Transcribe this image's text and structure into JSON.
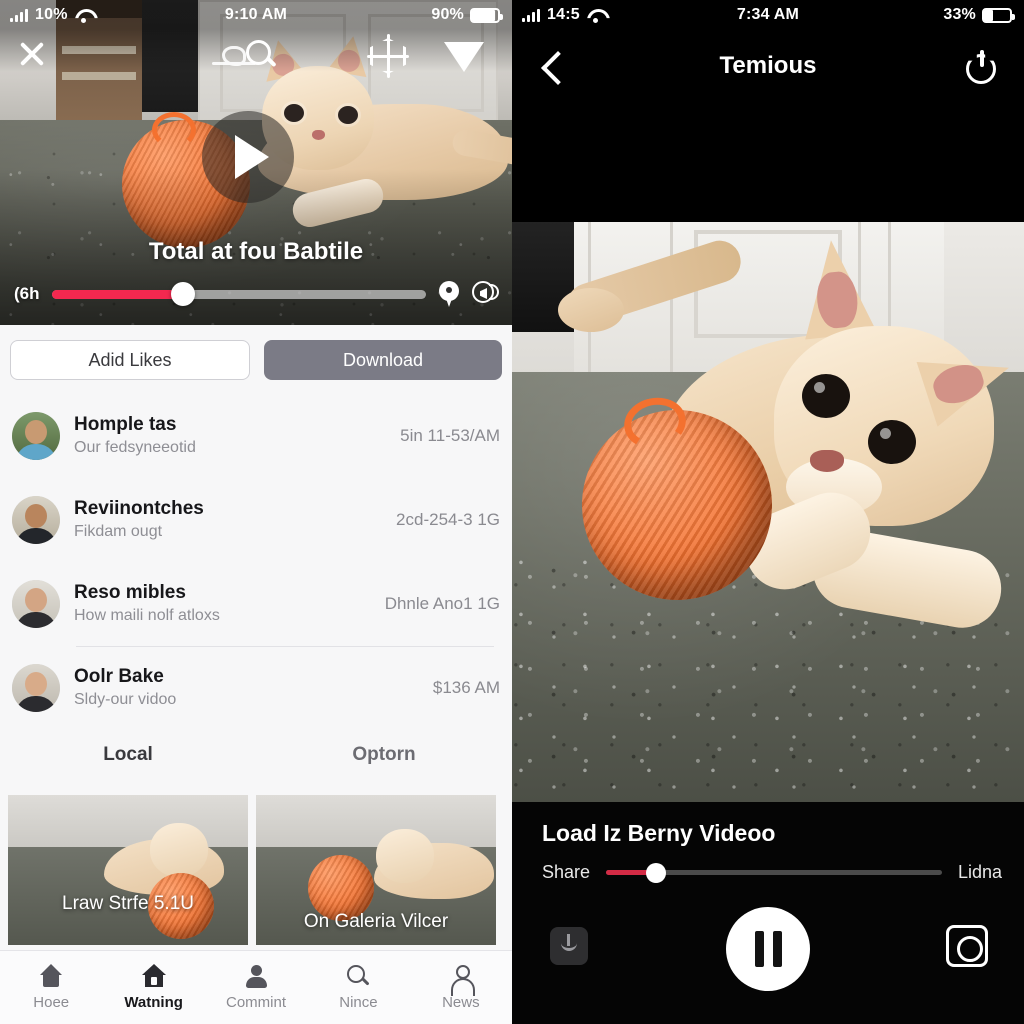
{
  "left": {
    "status": {
      "signal_label": "10%",
      "time": "9:10 AM",
      "battery": "90%",
      "battery_pct": 90
    },
    "overlay_icons": {
      "close": "close-icon",
      "search": "search-icon",
      "target": "target-icon",
      "triangle": "triangle-icon"
    },
    "video": {
      "title": "Total at fou Babtile",
      "elapsed": "(6h",
      "progress_pct": 35,
      "play_state": "paused"
    },
    "actions": {
      "secondary": "Adid Likes",
      "primary": "Download"
    },
    "list": [
      {
        "title": "Homple tas",
        "subtitle": "Our fedsyneeotid",
        "meta": "5in 11-53/AM"
      },
      {
        "title": "Reviinontches",
        "subtitle": "Fikdam ougt",
        "meta": "2cd-254-3 1G"
      },
      {
        "title": "Reso mibles",
        "subtitle": "How maili nolf atloxs",
        "meta": "Dhnle Ano1 1G"
      },
      {
        "title": "Oolr Bake",
        "subtitle": "Sldy-our vidoo",
        "meta": "$136 AM"
      }
    ],
    "tabs": [
      {
        "label": "Local",
        "active": true
      },
      {
        "label": "Optorn",
        "active": false
      }
    ],
    "cards": [
      {
        "caption": "Lraw Strfe 5.1U"
      },
      {
        "caption": "On Galeria Vilcer"
      }
    ],
    "nav": [
      {
        "label": "Hoee",
        "icon": "home-icon",
        "active": false
      },
      {
        "label": "Watning",
        "icon": "house-icon",
        "active": true
      },
      {
        "label": "Commint",
        "icon": "person-filled-icon",
        "active": false
      },
      {
        "label": "Nince",
        "icon": "search-icon",
        "active": false
      },
      {
        "label": "News",
        "icon": "person-outline-icon",
        "active": false
      }
    ]
  },
  "right": {
    "status": {
      "signal_label": "14:5",
      "time": "7:34 AM",
      "battery": "33%",
      "battery_pct": 33
    },
    "header": {
      "title": "Temious",
      "back": "back-chevron-icon",
      "power": "power-icon"
    },
    "player": {
      "title": "Load Iz Berny Videoo",
      "left_label": "Share",
      "right_label": "Lidna",
      "progress_pct": 15,
      "play_state": "playing"
    },
    "controls": {
      "download": "download-icon",
      "pause": "pause-icon",
      "capture": "capture-icon"
    }
  },
  "colors": {
    "accent_left": "#f3284f",
    "accent_right": "#d32b45",
    "primary_button": "#7b7b86",
    "nav_active": "#19191c"
  }
}
